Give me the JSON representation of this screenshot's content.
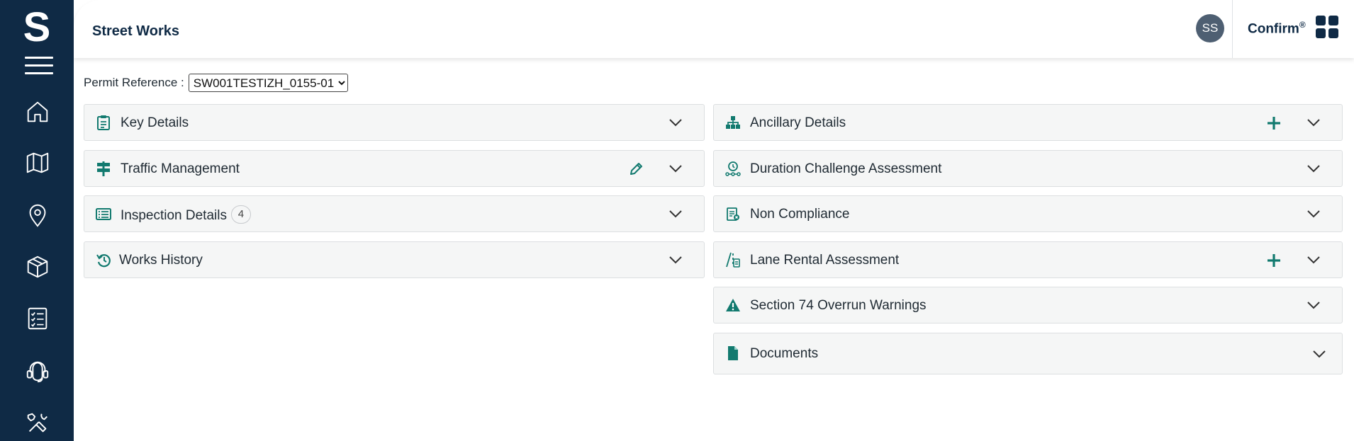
{
  "header": {
    "title": "Street Works",
    "avatar_initials": "SS",
    "brand": "Confirm",
    "brand_mark": "®"
  },
  "sidebar": {
    "logo": "S",
    "items": [
      {
        "icon": "home-icon"
      },
      {
        "icon": "map-icon"
      },
      {
        "icon": "location-pin-icon"
      },
      {
        "icon": "box-icon"
      },
      {
        "icon": "checklist-icon"
      },
      {
        "icon": "support-headset-icon"
      },
      {
        "icon": "tools-icon"
      }
    ]
  },
  "permit": {
    "label": "Permit Reference :",
    "selected": "SW001TESTIZH_0155-01"
  },
  "left_panels": [
    {
      "title": "Key Details",
      "icon": "clipboard-icon"
    },
    {
      "title": "Traffic Management",
      "icon": "signpost-icon",
      "action": "edit"
    },
    {
      "title": "Inspection Details",
      "icon": "list-icon",
      "count": "4"
    },
    {
      "title": "Works History",
      "icon": "history-icon"
    }
  ],
  "right_panels": [
    {
      "title": "Ancillary Details",
      "icon": "hierarchy-icon",
      "action": "add"
    },
    {
      "title": "Duration Challenge Assessment",
      "icon": "timeline-icon"
    },
    {
      "title": "Non Compliance",
      "icon": "report-icon"
    },
    {
      "title": "Lane Rental Assessment",
      "icon": "lane-icon",
      "action": "add"
    },
    {
      "title": "Section 74 Overrun Warnings",
      "icon": "warning-icon"
    },
    {
      "title": "Documents",
      "icon": "document-icon"
    }
  ],
  "colors": {
    "sidebar": "#0f2a45",
    "accent": "#127a6f",
    "panel_bg": "#f5f6f6"
  }
}
